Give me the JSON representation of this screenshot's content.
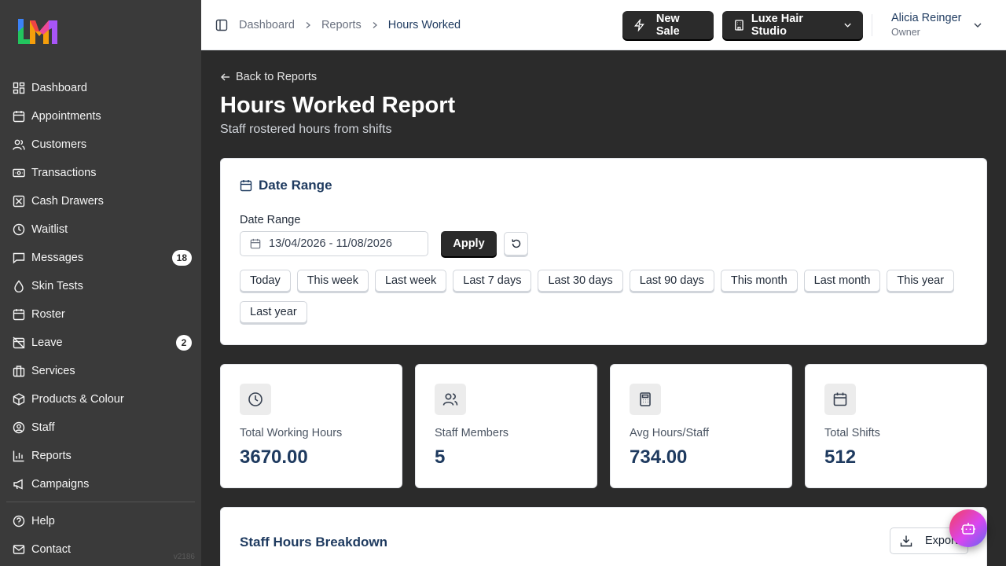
{
  "app": {
    "version": "v2186"
  },
  "sidebar": {
    "items": [
      {
        "label": "Dashboard",
        "icon": "dashboard-icon"
      },
      {
        "label": "Appointments",
        "icon": "calendar-icon"
      },
      {
        "label": "Customers",
        "icon": "users-icon"
      },
      {
        "label": "Transactions",
        "icon": "banknote-icon"
      },
      {
        "label": "Cash Drawers",
        "icon": "cash-drawer-icon"
      },
      {
        "label": "Waitlist",
        "icon": "clock-icon"
      },
      {
        "label": "Messages",
        "icon": "message-icon",
        "badge": "18"
      },
      {
        "label": "Skin Tests",
        "icon": "droplet-icon"
      },
      {
        "label": "Roster",
        "icon": "calendar-clock-icon"
      },
      {
        "label": "Leave",
        "icon": "calendar-off-icon",
        "badge": "2"
      },
      {
        "label": "Services",
        "icon": "briefcase-icon"
      },
      {
        "label": "Products & Colour",
        "icon": "package-icon"
      },
      {
        "label": "Staff",
        "icon": "user-circle-icon"
      },
      {
        "label": "Reports",
        "icon": "bar-chart-icon"
      },
      {
        "label": "Campaigns",
        "icon": "megaphone-icon"
      }
    ],
    "footer_items": [
      {
        "label": "Help",
        "icon": "help-icon"
      },
      {
        "label": "Contact",
        "icon": "mail-icon"
      }
    ]
  },
  "header": {
    "breadcrumb": [
      "Dashboard",
      "Reports",
      "Hours Worked"
    ],
    "new_sale_label": "New Sale",
    "studio_label": "Luxe Hair Studio",
    "user_name": "Alicia Reinger",
    "user_role": "Owner"
  },
  "main": {
    "back_label": "Back to Reports",
    "title": "Hours Worked Report",
    "subtitle": "Staff rostered hours from shifts",
    "date_card": {
      "heading": "Date Range",
      "field_label": "Date Range",
      "range_value": "13/04/2026 - 11/08/2026",
      "apply_label": "Apply",
      "presets": [
        "Today",
        "This week",
        "Last week",
        "Last 7 days",
        "Last 30 days",
        "Last 90 days",
        "This month",
        "Last month",
        "This year",
        "Last year"
      ]
    },
    "stats": [
      {
        "label": "Total Working Hours",
        "value": "3670.00",
        "icon": "clock-icon"
      },
      {
        "label": "Staff Members",
        "value": "5",
        "icon": "users-icon"
      },
      {
        "label": "Avg Hours/Staff",
        "value": "734.00",
        "icon": "calculator-icon"
      },
      {
        "label": "Total Shifts",
        "value": "512",
        "icon": "calendar-icon"
      }
    ],
    "breakdown": {
      "title": "Staff Hours Breakdown",
      "export_label": "Export"
    }
  },
  "colors": {
    "sidebar_bg": "#3a3a3a",
    "main_bg": "#2b2b2b",
    "accent_navy": "#1e3a5f",
    "button_dark": "#2b2b2b"
  }
}
